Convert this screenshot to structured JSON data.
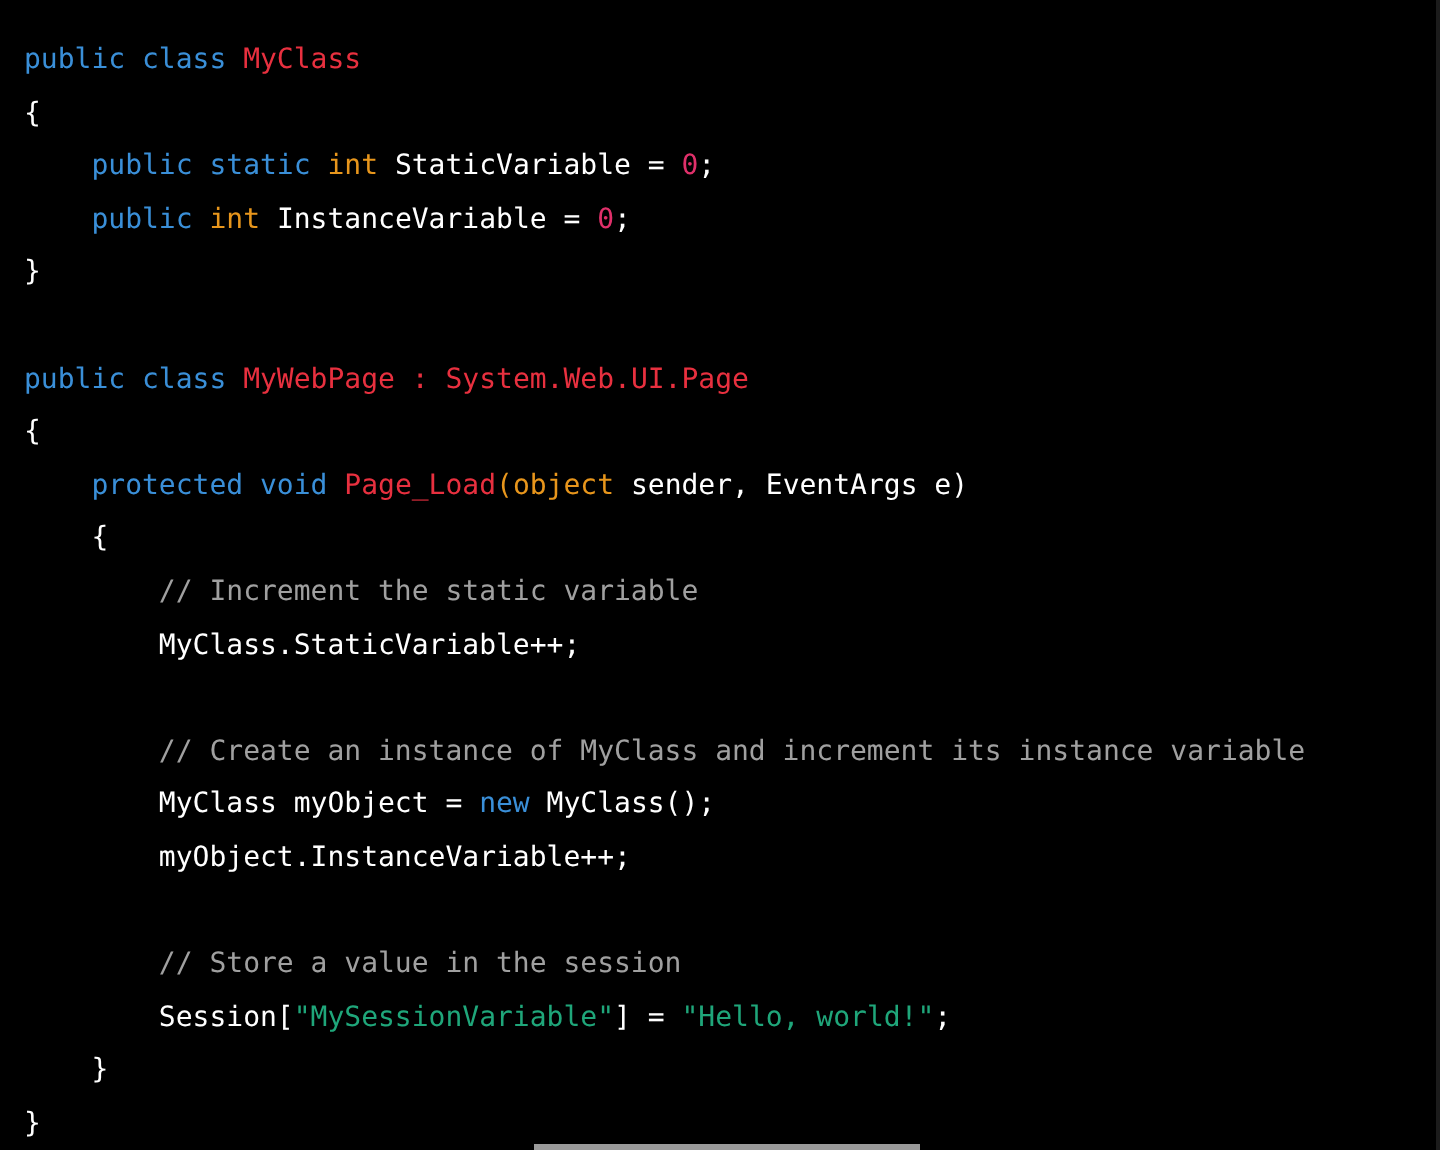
{
  "code_lines": [
    {
      "kind": "code",
      "tokens": [
        {
          "text": "public class ",
          "kind": "keyword"
        },
        {
          "text": "MyClass",
          "kind": "type"
        }
      ]
    },
    {
      "kind": "code",
      "tokens": [
        {
          "text": "{",
          "kind": "plain"
        }
      ]
    },
    {
      "kind": "code",
      "tokens": [
        {
          "text": "    public static ",
          "kind": "keyword"
        },
        {
          "text": "int",
          "kind": "builtin"
        },
        {
          "text": " StaticVariable = ",
          "kind": "plain"
        },
        {
          "text": "0",
          "kind": "number"
        },
        {
          "text": ";",
          "kind": "plain"
        }
      ]
    },
    {
      "kind": "code",
      "tokens": [
        {
          "text": "    public ",
          "kind": "keyword"
        },
        {
          "text": "int",
          "kind": "builtin"
        },
        {
          "text": " InstanceVariable = ",
          "kind": "plain"
        },
        {
          "text": "0",
          "kind": "number"
        },
        {
          "text": ";",
          "kind": "plain"
        }
      ]
    },
    {
      "kind": "code",
      "tokens": [
        {
          "text": "}",
          "kind": "plain"
        }
      ]
    },
    {
      "kind": "blank"
    },
    {
      "kind": "code",
      "tokens": [
        {
          "text": "public class ",
          "kind": "keyword"
        },
        {
          "text": "MyWebPage : System.Web.UI.Page",
          "kind": "type"
        }
      ]
    },
    {
      "kind": "code",
      "tokens": [
        {
          "text": "{",
          "kind": "plain"
        }
      ]
    },
    {
      "kind": "code",
      "tokens": [
        {
          "text": "    protected void ",
          "kind": "keyword"
        },
        {
          "text": "Page_Load",
          "kind": "type"
        },
        {
          "text": "(",
          "kind": "builtin"
        },
        {
          "text": "object",
          "kind": "builtin"
        },
        {
          "text": " sender, EventArgs e)",
          "kind": "plain"
        }
      ]
    },
    {
      "kind": "code",
      "tokens": [
        {
          "text": "    {",
          "kind": "plain"
        }
      ]
    },
    {
      "kind": "code",
      "tokens": [
        {
          "text": "        // Increment the static variable",
          "kind": "comment"
        }
      ]
    },
    {
      "kind": "code",
      "tokens": [
        {
          "text": "        MyClass.StaticVariable++;",
          "kind": "plain"
        }
      ]
    },
    {
      "kind": "blank"
    },
    {
      "kind": "code",
      "tokens": [
        {
          "text": "        // Create an instance of MyClass and increment its instance variable",
          "kind": "comment"
        }
      ]
    },
    {
      "kind": "code",
      "tokens": [
        {
          "text": "        MyClass myObject = ",
          "kind": "plain"
        },
        {
          "text": "new",
          "kind": "keyword"
        },
        {
          "text": " MyClass();",
          "kind": "plain"
        }
      ]
    },
    {
      "kind": "code",
      "tokens": [
        {
          "text": "        myObject.InstanceVariable++;",
          "kind": "plain"
        }
      ]
    },
    {
      "kind": "blank"
    },
    {
      "kind": "code",
      "tokens": [
        {
          "text": "        // Store a value in the session",
          "kind": "comment"
        }
      ]
    },
    {
      "kind": "code",
      "tokens": [
        {
          "text": "        Session[",
          "kind": "plain"
        },
        {
          "text": "\"MySessionVariable\"",
          "kind": "string"
        },
        {
          "text": "] = ",
          "kind": "plain"
        },
        {
          "text": "\"Hello, world!\"",
          "kind": "string"
        },
        {
          "text": ";",
          "kind": "plain"
        }
      ]
    },
    {
      "kind": "code",
      "tokens": [
        {
          "text": "    }",
          "kind": "plain"
        }
      ]
    },
    {
      "kind": "code",
      "tokens": [
        {
          "text": "}",
          "kind": "plain"
        }
      ]
    }
  ]
}
